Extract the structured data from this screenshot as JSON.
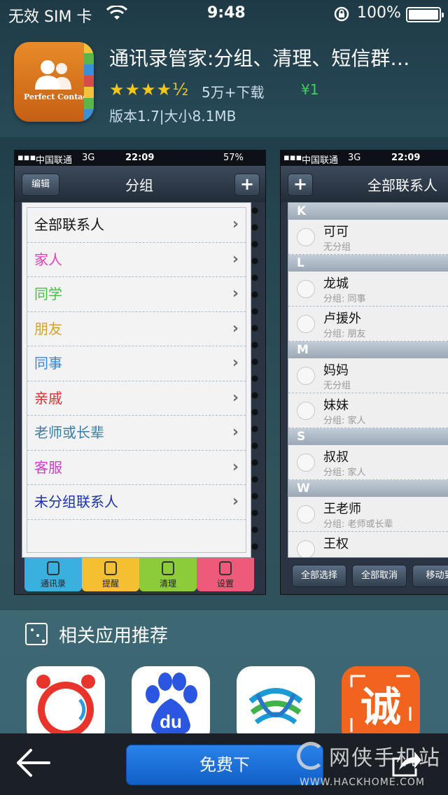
{
  "status_bar": {
    "carrier": "无效 SIM 卡",
    "time": "9:48",
    "battery": "100%"
  },
  "app": {
    "title": "通讯录管家:分组、清理、短信群…",
    "icon_text": "Perfect Contacts",
    "rating_stars": "★★★★½",
    "rating_value": 4.5,
    "downloads": "5万+下载",
    "price": "¥1",
    "version_size": "版本1.7|大小8.1MB"
  },
  "screenshot1": {
    "status": {
      "carrier": "中国联通",
      "network": "3G",
      "time": "22:09",
      "battery": "57%"
    },
    "edit_label": "编辑",
    "title": "分组",
    "plus_label": "+",
    "groups": [
      {
        "label": "全部联系人",
        "color": "#111111"
      },
      {
        "label": "家人",
        "color": "#e83fb8"
      },
      {
        "label": "同学",
        "color": "#3fc43f"
      },
      {
        "label": "朋友",
        "color": "#d6a22c"
      },
      {
        "label": "同事",
        "color": "#3a86d8"
      },
      {
        "label": "亲戚",
        "color": "#d83030"
      },
      {
        "label": "老师或长辈",
        "color": "#3a7ea8"
      },
      {
        "label": "客服",
        "color": "#d43ad4"
      },
      {
        "label": "未分组联系人",
        "color": "#1830b8"
      }
    ],
    "tabs": [
      {
        "label": "通讯录",
        "color": "#3ab0de"
      },
      {
        "label": "提醒",
        "color": "#f4c032"
      },
      {
        "label": "清理",
        "color": "#8ccc3a"
      },
      {
        "label": "设置",
        "color": "#ee5a7a"
      }
    ]
  },
  "screenshot2": {
    "status": {
      "carrier": "中国联通",
      "network": "3G",
      "time": "22:09"
    },
    "plus_label": "+",
    "title": "全部联系人",
    "sections": [
      {
        "letter": "K",
        "contacts": [
          {
            "name": "可可",
            "group": "无分组"
          }
        ]
      },
      {
        "letter": "L",
        "contacts": [
          {
            "name": "龙城",
            "group": "分组: 同事"
          },
          {
            "name": "卢援外",
            "group": "分组: 朋友"
          }
        ]
      },
      {
        "letter": "M",
        "contacts": [
          {
            "name": "妈妈",
            "group": "无分组"
          },
          {
            "name": "妹妹",
            "group": "分组: 家人"
          }
        ]
      },
      {
        "letter": "S",
        "contacts": [
          {
            "name": "叔叔",
            "group": "分组: 家人"
          }
        ]
      },
      {
        "letter": "W",
        "contacts": [
          {
            "name": "王老师",
            "group": "分组: 老师或长辈"
          },
          {
            "name": "王权",
            "group": ""
          }
        ]
      }
    ],
    "buttons": {
      "select_all": "全部选择",
      "deselect_all": "全部取消",
      "move": "移动到"
    }
  },
  "related": {
    "title": "相关应用推荐",
    "apps": [
      {
        "icon": "browser-app-icon"
      },
      {
        "icon": "baidu-app-icon",
        "text": "du"
      },
      {
        "icon": "china-mobile-app-icon"
      },
      {
        "icon": "cheng-app-icon",
        "text": "诚"
      }
    ]
  },
  "bottom": {
    "install_label": "免费下",
    "watermark_cn": "网侠手机站",
    "watermark_en": "WWW.HACKHOME.COM"
  },
  "colors": {
    "accent_blue": "#1a72dc",
    "price_green": "#3fd05a",
    "star_gold": "#f5c518"
  }
}
